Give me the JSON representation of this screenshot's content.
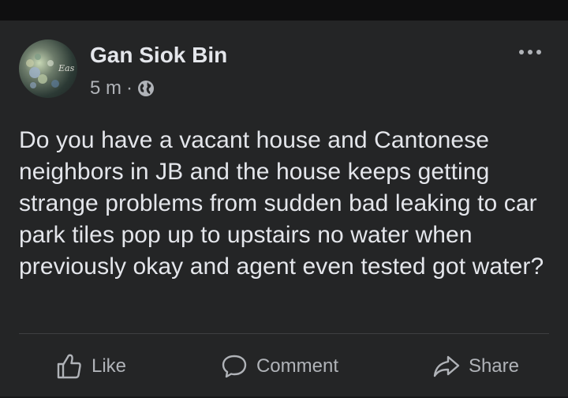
{
  "post": {
    "author": "Gan Siok Bin",
    "time": "5 m",
    "separator": "·",
    "audience_icon": "globe-icon",
    "avatar_watermark": "Eas",
    "text": "Do you have a vacant house and Cantonese neighbors in JB and the house keeps getting strange problems from sudden bad leaking to car park tiles pop up to upstairs no water when previously okay and agent even tested got water?"
  },
  "actions": {
    "like": "Like",
    "comment": "Comment",
    "share": "Share"
  },
  "colors": {
    "card_bg": "#242526",
    "page_bg": "#18191a",
    "primary_text": "#e4e6eb",
    "secondary_text": "#b0b3b8"
  }
}
